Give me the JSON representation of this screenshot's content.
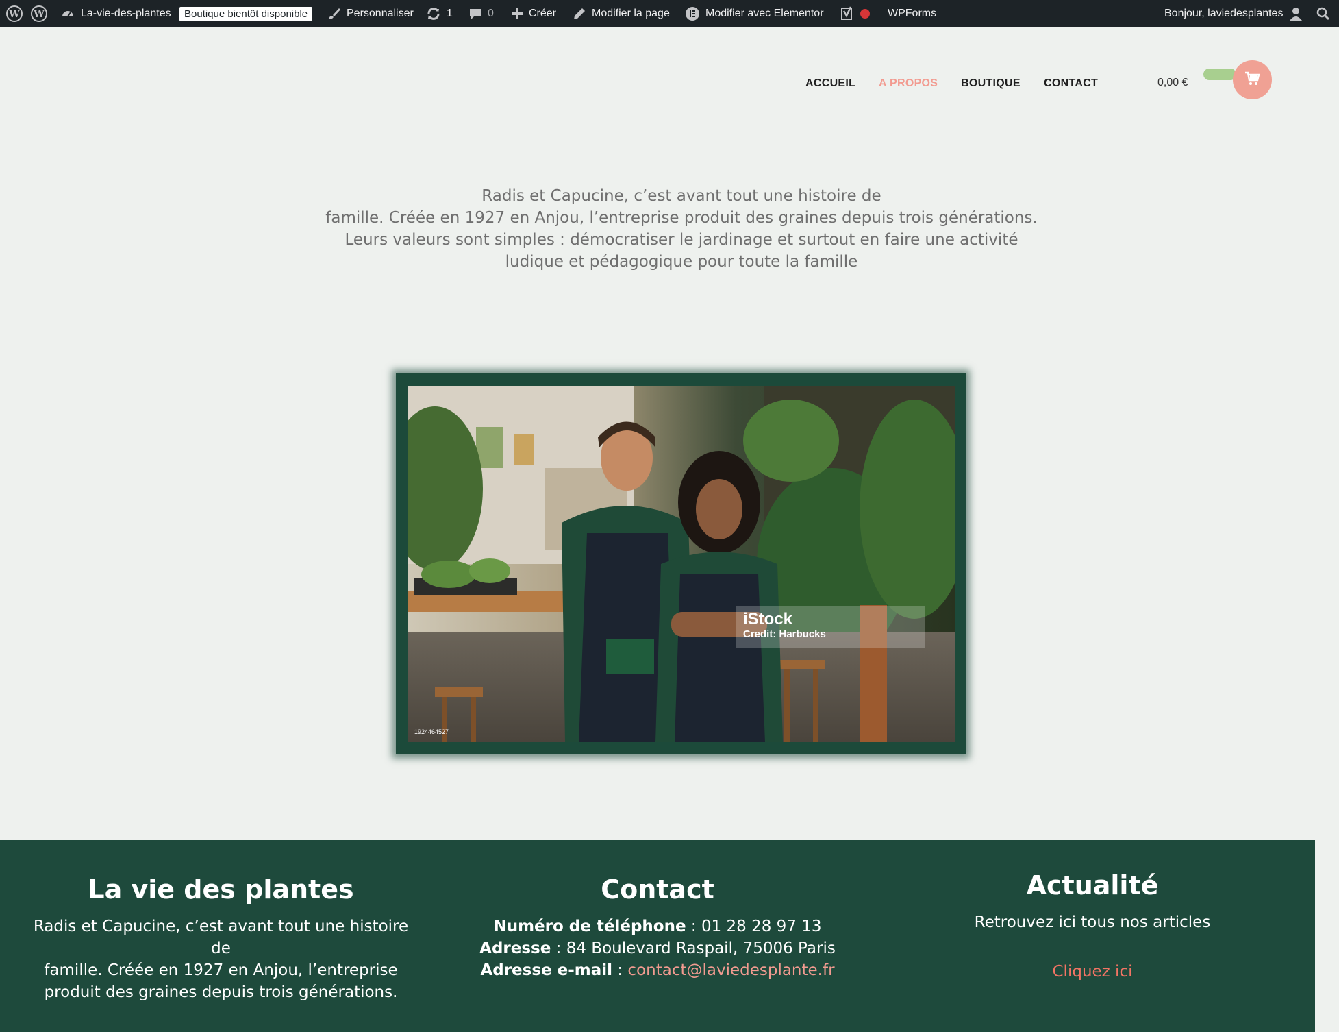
{
  "admin_bar": {
    "site_name": "La-vie-des-plantes",
    "badge": "Boutique bientôt disponible",
    "customize": "Personnaliser",
    "updates_count": "1",
    "comments_count": "0",
    "create": "Créer",
    "edit_page": "Modifier la page",
    "edit_elementor": "Modifier avec Elementor",
    "wpforms": "WPForms",
    "greeting": "Bonjour, laviedesplantes"
  },
  "nav": {
    "items": [
      {
        "label": "ACCUEIL"
      },
      {
        "label": "A PROPOS"
      },
      {
        "label": "BOUTIQUE"
      },
      {
        "label": "CONTACT"
      }
    ],
    "cart_total": "0,00 €"
  },
  "intro": {
    "lines": [
      "Radis et Capucine, c’est avant tout une histoire de",
      "famille. Créée en 1927 en Anjou, l’entreprise produit des graines depuis trois générations.",
      "Leurs valeurs sont simples : démocratiser le jardinage et surtout en faire une activité",
      "ludique et pédagogique pour toute la famille"
    ]
  },
  "photo": {
    "watermark": "iStock",
    "credit": "Credit: Harbucks",
    "id": "1924464527"
  },
  "footer": {
    "col1": {
      "title": "La vie des plantes",
      "lines": [
        "Radis et Capucine, c’est avant tout une histoire",
        "de",
        "famille. Créée en 1927 en Anjou, l’entreprise",
        "produit des graines depuis trois générations."
      ]
    },
    "col2": {
      "title": "Contact",
      "phone_label": "Numéro de téléphone",
      "phone": " : 01 28 28 97 13",
      "address_label": "Adresse",
      "address": " : 84 Boulevard Raspail, 75006 Paris",
      "email_label": "Adresse e-mail",
      "email_sep": " : ",
      "email": "contact@laviedesplante.fr"
    },
    "col3": {
      "title": "Actualité",
      "text": "Retrouvez ici tous nos articles",
      "link": "Cliquez ici"
    }
  },
  "colors": {
    "accent": "#f29b90",
    "footer_bg": "#1e4a3c",
    "admin_bg": "#1d2327",
    "cart_pill": "#a8cf8f"
  }
}
